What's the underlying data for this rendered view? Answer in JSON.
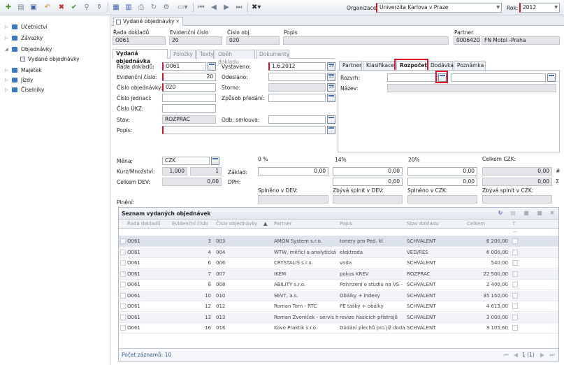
{
  "toolbar": {
    "organization_label": "Organizace:",
    "organization_value": "Univerzita Karlova v Praze",
    "year_label": "Rok:",
    "year_value": "2012"
  },
  "sidebar": {
    "items": [
      {
        "label": "Účetnictví",
        "expanded": false
      },
      {
        "label": "Závazky",
        "expanded": false
      },
      {
        "label": "Objednávky",
        "expanded": true
      },
      {
        "label": "Vydané objednávky",
        "sub": true
      },
      {
        "label": "Majetek",
        "expanded": false
      },
      {
        "label": "Jízdy",
        "expanded": false
      },
      {
        "label": "Číselníky",
        "expanded": false
      }
    ]
  },
  "document_tab": {
    "label": "Vydané objednávky"
  },
  "header": {
    "rada_label": "Řada dokladů",
    "rada_value": "O061",
    "evid_label": "Evidenční číslo",
    "evid_value": "20",
    "cislo_label": "Číslo obj.",
    "cislo_value": "020",
    "popis_label": "Popis",
    "popis_value": "",
    "partner_label": "Partner",
    "partner_code": "00064203",
    "partner_name": "FN  Motol -Praha"
  },
  "form_tabs": [
    "Vydaná objednávka",
    "Položky",
    "Texty",
    "Oběh dokladu",
    "Dokumenty"
  ],
  "form": {
    "rada_label": "Řada dokladů:",
    "rada_value": "O061",
    "evid_label": "Evidenční číslo:",
    "evid_value": "20",
    "cislo_label": "Číslo objednávky:",
    "cislo_value": "020",
    "jednaci_label": "Číslo jednací:",
    "ukz_label": "Číslo ÚKZ:",
    "stav_label": "Stav:",
    "stav_value": "ROZPRAC",
    "popis_label": "Popis:",
    "vystaveno_label": "Vystaveno:",
    "vystaveno_value": "1.6.2012",
    "odeslano_label": "Odesláno:",
    "storno_label": "Storno:",
    "zpusob_label": "Způsob předání:",
    "odb_label": "Odb. smlouva:",
    "cal_text": "15"
  },
  "side_tabs": [
    "Partner",
    "Klasifikace",
    "Rozpočet",
    "Dodávka",
    "Poznámka"
  ],
  "rozpocet": {
    "rozvrh_label": "Rozvrh:",
    "nazev_label": "Název:"
  },
  "finance": {
    "mena_label": "Měna:",
    "mena_value": "CZK",
    "kurz_label": "Kurz/Množství:",
    "kurz_value": "1,000",
    "mnozstvi_value": "1",
    "celkem_dev_label": "Celkem DEV:",
    "celkem_dev_value": "0,00",
    "zaklad_label": "Základ:",
    "dph_label": "DPH:",
    "p0_label": "0 %",
    "p14_label": "14%",
    "p20_label": "20%",
    "celkem_czk_label": "Celkem CZK:",
    "zero": "0,00",
    "hash": "#",
    "sigma": "Σ",
    "plneni_label": "Plnění:",
    "splneno_dev_label": "Splněno v DEV:",
    "zbyva_dev_label": "Zbývá splnit v DEV:",
    "splneno_czk_label": "Splněno v CZK:",
    "zbyva_czk_label": "Zbývá splnit v CZK:"
  },
  "grid": {
    "title": "Seznam vydaných objednávek",
    "columns": [
      "Řada dokladů",
      "Evidenční číslo",
      "Číslo objednávky",
      "Partner",
      "Popis",
      "Stav dokladu",
      "Celkem",
      "T"
    ],
    "rows": [
      {
        "rada": "O061",
        "evid": "3",
        "cislo": "003",
        "partner": "AMON  System  s.r.o.",
        "popis": "tonery pro Ped. kl.",
        "stav": "SCHVÁLENT",
        "celkem": "6 200,00"
      },
      {
        "rada": "O061",
        "evid": "4",
        "cislo": "004",
        "partner": "WTW, měřicí a analytická",
        "popis": "elektroda",
        "stav": "VED/ŘEŠ",
        "celkem": "6 000,00"
      },
      {
        "rada": "O061",
        "evid": "6",
        "cislo": "006",
        "partner": "CRYSTALIS s.r.o.",
        "popis": "voda",
        "stav": "SCHVÁLENT",
        "celkem": "540,00"
      },
      {
        "rada": "O061",
        "evid": "7",
        "cislo": "007",
        "partner": "IKEM",
        "popis": "  pokus   KREV",
        "stav": "ROZPRAC",
        "celkem": "22 500,00"
      },
      {
        "rada": "O061",
        "evid": "8",
        "cislo": "008",
        "partner": "ABILITY s.r.o.",
        "popis": "Potvrzení o studiu na VŠ -",
        "stav": "SCHVÁLENT",
        "celkem": "2 400,00"
      },
      {
        "rada": "O061",
        "evid": "10",
        "cislo": "010",
        "partner": "SEVT, a.s.",
        "popis": "Obálky + indexy",
        "stav": "SCHVÁLENT",
        "celkem": "35 150,00"
      },
      {
        "rada": "O061",
        "evid": "12",
        "cislo": "012",
        "partner": "Roman Torn - RTC",
        "popis": "PE tašky + obálky",
        "stav": "SCHVÁLENT",
        "celkem": "4 613,00"
      },
      {
        "rada": "O061",
        "evid": "13",
        "cislo": "013",
        "partner": "Roman Zvoníček - servis h",
        "popis": "revize hasicích přístrojů",
        "stav": "SCHVÁLENT",
        "celkem": "3 000,00"
      },
      {
        "rada": "O061",
        "evid": "16",
        "cislo": "016",
        "partner": "Kovo Praktik s.r.o.",
        "popis": "Dodání plechů pro již doda",
        "stav": "SCHVÁLENT",
        "celkem": "3 105,60"
      }
    ],
    "footer_count": "Počet záznamů: 10",
    "pager": "1 (1)"
  }
}
